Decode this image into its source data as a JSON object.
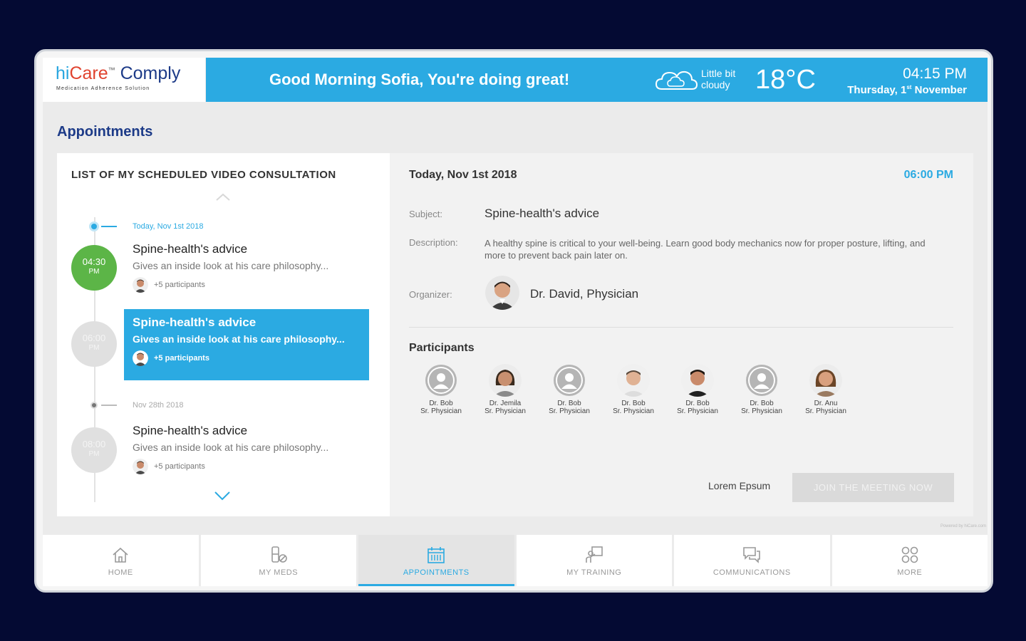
{
  "brand": {
    "hi": "hi",
    "care": "Care",
    "tm": "™",
    "comply": " Comply",
    "tagline": "Medication Adherence Solution"
  },
  "header": {
    "greeting": "Good Morning Sofia, You're doing great!",
    "weather": "Little bit cloudy",
    "weather_icon": "cloud-icon",
    "temperature": "18°C",
    "time": "04:15 PM",
    "date_day": "Thursday,",
    "date_num": "1",
    "date_sup": "st",
    "date_month": "November"
  },
  "page": {
    "title": "Appointments"
  },
  "list": {
    "heading": "LIST OF MY SCHEDULED VIDEO CONSULTATION",
    "groups": [
      {
        "label": "Today, Nov 1st 2018"
      },
      {
        "label": "Nov 28th 2018"
      }
    ],
    "items": [
      {
        "time": "04:30",
        "ampm": "PM",
        "title": "Spine-health's advice",
        "desc": "Gives an inside look at his care philosophy...",
        "participants": "+5 participants",
        "color": "#5cb547"
      },
      {
        "time": "06:00",
        "ampm": "PM",
        "title": "Spine-health's advice",
        "desc": "Gives an inside look at his care philosophy...",
        "participants": "+5 participants",
        "color": "#e0e0e0"
      },
      {
        "time": "08:00",
        "ampm": "PM",
        "title": "Spine-health's advice",
        "desc": "Gives an inside look at his care philosophy...",
        "participants": "+5 participants",
        "color": "#e0e0e0"
      }
    ]
  },
  "detail": {
    "date": "Today, Nov 1st 2018",
    "time": "06:00 PM",
    "subject_label": "Subject:",
    "subject": "Spine-health's advice",
    "description_label": "Description:",
    "description": "A healthy spine is critical to your well-being. Learn good body mechanics now for proper posture, lifting, and more to prevent back pain later on.",
    "organizer_label": "Organizer:",
    "organizer": "Dr. David, Physician",
    "participants_heading": "Participants",
    "participants": [
      {
        "name": "Dr. Bob",
        "role": "Sr. Physician",
        "avatar": "placeholder"
      },
      {
        "name": "Dr. Jemila",
        "role": "Sr. Physician",
        "avatar": "photo"
      },
      {
        "name": "Dr. Bob",
        "role": "Sr. Physician",
        "avatar": "placeholder"
      },
      {
        "name": "Dr. Bob",
        "role": "Sr. Physician",
        "avatar": "photo"
      },
      {
        "name": "Dr. Bob",
        "role": "Sr. Physician",
        "avatar": "photo"
      },
      {
        "name": "Dr. Bob",
        "role": "Sr. Physician",
        "avatar": "placeholder"
      },
      {
        "name": "Dr. Anu",
        "role": "Sr. Physician",
        "avatar": "photo"
      }
    ],
    "secondary_action": "Lorem Epsum",
    "join_button": "JOIN THE MEETING NOW",
    "powered_by": "Powered by hiCare.com"
  },
  "nav": [
    {
      "label": "HOME",
      "icon": "home-icon"
    },
    {
      "label": "MY MEDS",
      "icon": "pills-icon"
    },
    {
      "label": "APPOINTMENTS",
      "icon": "calendar-icon",
      "active": true
    },
    {
      "label": "MY TRAINING",
      "icon": "training-icon"
    },
    {
      "label": "COMMUNICATIONS",
      "icon": "chat-icon"
    },
    {
      "label": "MORE",
      "icon": "grid-icon"
    }
  ],
  "colors": {
    "accent": "#2baae2",
    "brand_navy": "#1d3b88",
    "green": "#5cb547",
    "background": "#040a33"
  }
}
